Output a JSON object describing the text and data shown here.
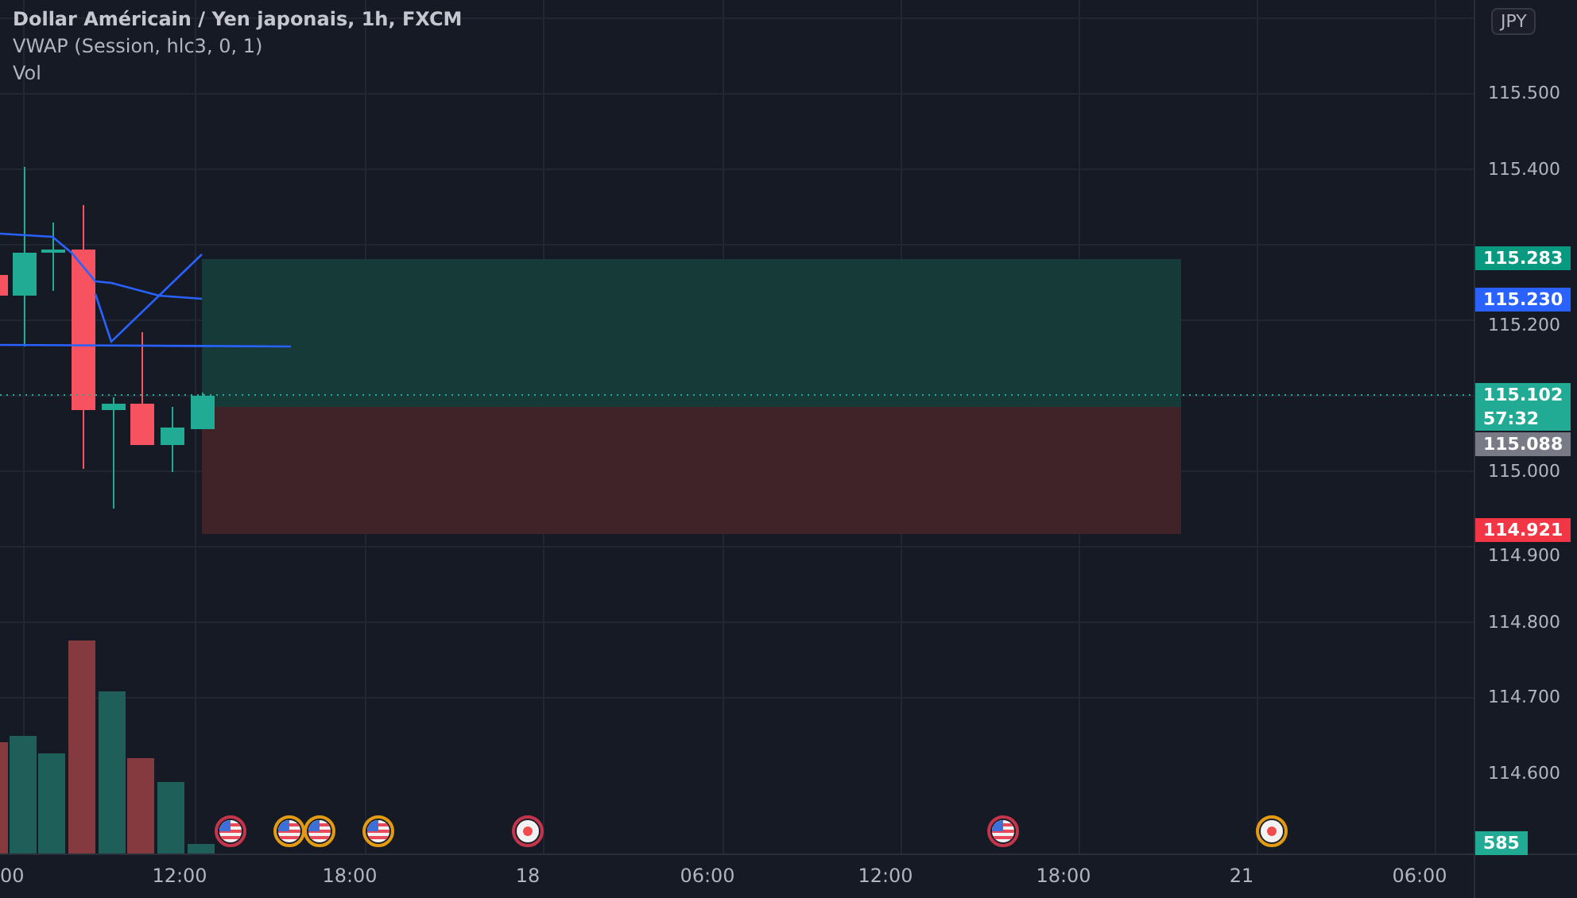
{
  "legend": {
    "title": "Dollar Américain / Yen japonais, 1h, FXCM",
    "indicators": [
      "VWAP (Session, hlc3, 0, 1)",
      "Vol"
    ]
  },
  "currency_badge": "JPY",
  "price_ticks": [
    "115.500",
    "115.400",
    "115.200",
    "115.000",
    "114.900",
    "114.800",
    "114.700",
    "114.600"
  ],
  "price_tags": [
    {
      "label": "115.283",
      "color": "#089981"
    },
    {
      "label": "115.230",
      "color": "#2962ff"
    },
    {
      "label": "115.102",
      "sublabel": "57:32",
      "color": "#22ab94"
    },
    {
      "label": "115.088",
      "color": "#787b86"
    },
    {
      "label": "114.921",
      "color": "#f23645"
    },
    {
      "label": "585",
      "color": "#22ab94"
    }
  ],
  "events": [
    {
      "kind": "flag",
      "color": "#c4344a"
    },
    {
      "kind": "flag",
      "color": "#e39b12"
    },
    {
      "kind": "flag",
      "color": "#e39b12"
    },
    {
      "kind": "flag",
      "color": "#e39b12"
    },
    {
      "kind": "dot",
      "color": "#c4344a"
    },
    {
      "kind": "flag",
      "color": "#c4344a"
    },
    {
      "kind": "dot",
      "color": "#e39b12"
    }
  ],
  "time_ticks": [
    "00",
    "12:00",
    "18:00",
    "18",
    "06:00",
    "12:00",
    "18:00",
    "21",
    "06:00"
  ]
}
